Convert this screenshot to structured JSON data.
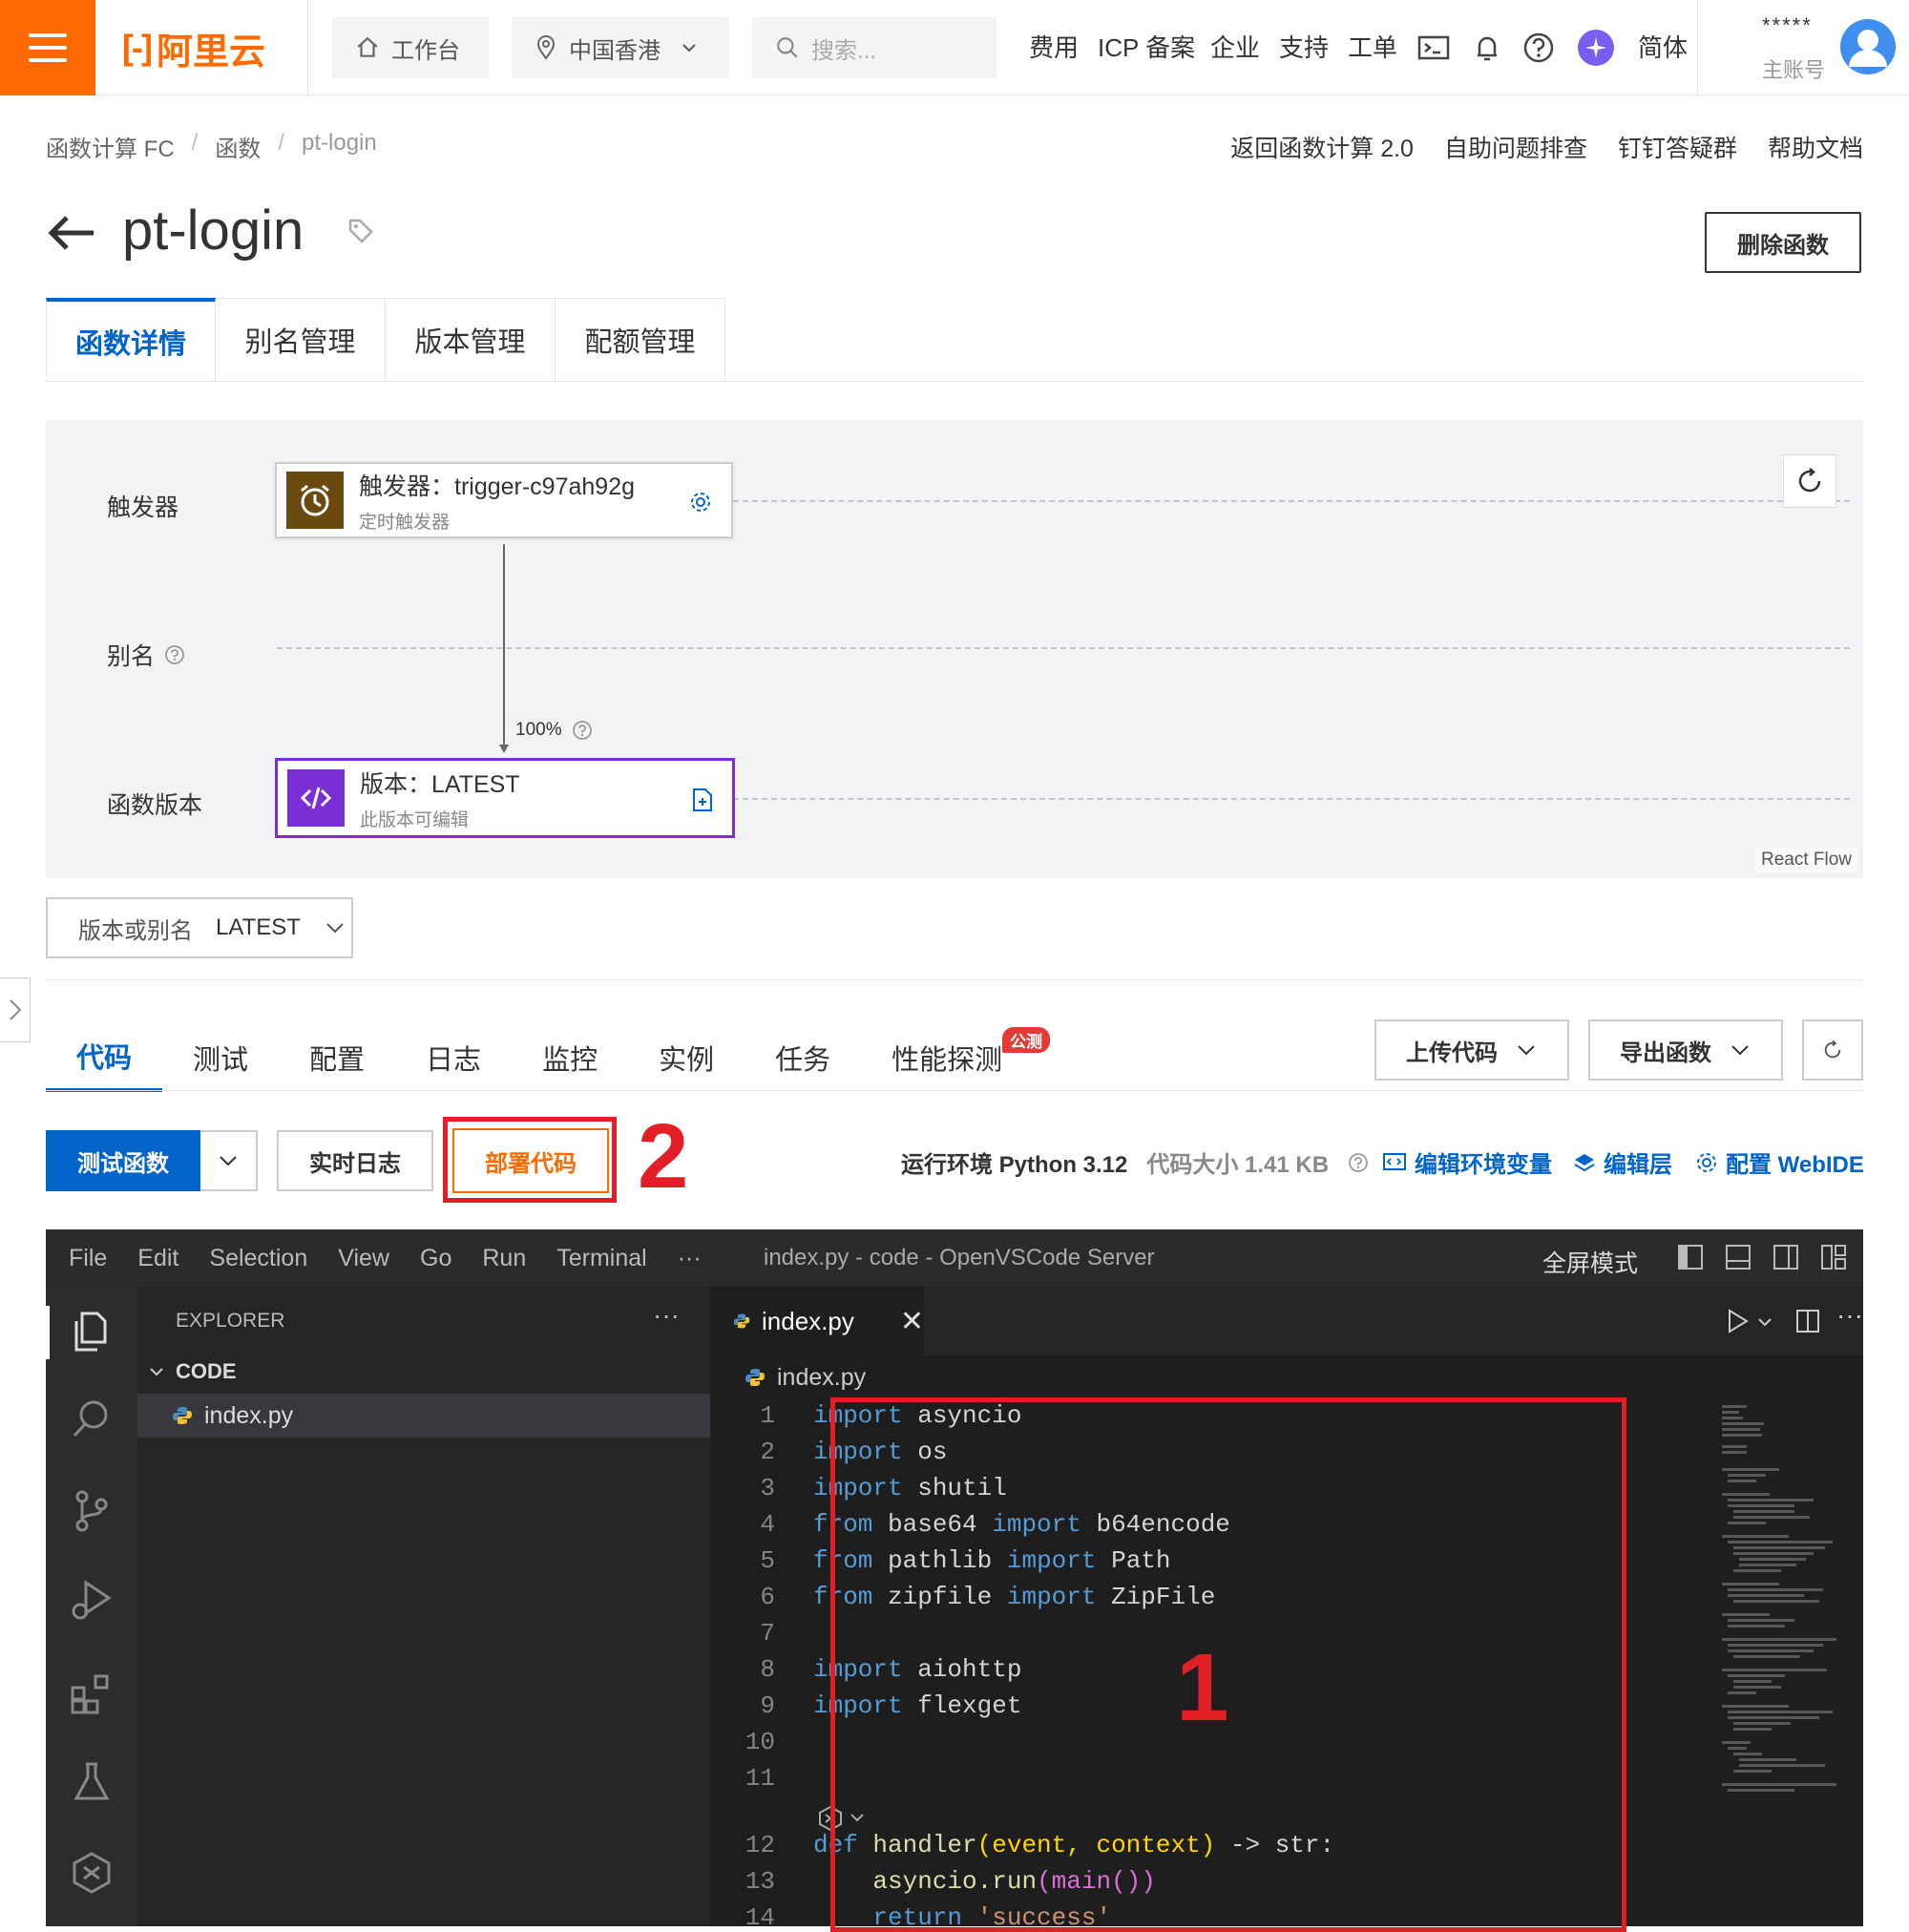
{
  "topbar": {
    "logo_text": "阿里云",
    "workbench": "工作台",
    "region": "中国香港",
    "search_placeholder": "搜索...",
    "links": [
      "费用",
      "ICP 备案",
      "企业",
      "支持",
      "工单"
    ],
    "lang": "简体",
    "account_mask": "*****",
    "account_role": "主账号",
    "brand_color": "#ff6a00"
  },
  "breadcrumb": [
    "函数计算 FC",
    "函数",
    "pt-login"
  ],
  "help_links": [
    "返回函数计算 2.0",
    "自助问题排查",
    "钉钉答疑群",
    "帮助文档"
  ],
  "page": {
    "title": "pt-login",
    "delete_label": "删除函数"
  },
  "main_tabs": [
    "函数详情",
    "别名管理",
    "版本管理",
    "配额管理"
  ],
  "flow": {
    "row_labels": [
      "触发器",
      "别名",
      "函数版本"
    ],
    "trigger": {
      "title": "触发器：trigger-c97ah92g",
      "subtitle": "定时触发器"
    },
    "percent": "100%",
    "version": {
      "title": "版本：LATEST",
      "subtitle": "此版本可编辑"
    },
    "attribution": "React Flow"
  },
  "version_select": {
    "label": "版本或别名",
    "value": "LATEST"
  },
  "sub_tabs": [
    "代码",
    "测试",
    "配置",
    "日志",
    "监控",
    "实例",
    "任务",
    "性能探测"
  ],
  "sub_tab_badge": "公测",
  "toolbar": {
    "upload": "上传代码",
    "export": "导出函数"
  },
  "actions": {
    "test": "测试函数",
    "logs": "实时日志",
    "deploy": "部署代码",
    "annotation_2": "2"
  },
  "runtime": {
    "env": "运行环境 Python 3.12",
    "size": "代码大小 1.41 KB",
    "edit_env": "编辑环境变量",
    "edit_layer": "编辑层",
    "webide": "配置 WebIDE"
  },
  "ide": {
    "menus": [
      "File",
      "Edit",
      "Selection",
      "View",
      "Go",
      "Run",
      "Terminal",
      "···"
    ],
    "window_title": "index.py - code - OpenVSCode Server",
    "fullscreen": "全屏模式",
    "explorer_title": "EXPLORER",
    "folder": "CODE",
    "file": "index.py",
    "tab": "index.py",
    "breadcrumb_file": "index.py",
    "annotation_1": "1",
    "line_numbers": [
      "1",
      "2",
      "3",
      "4",
      "5",
      "6",
      "7",
      "8",
      "9",
      "10",
      "11",
      "12",
      "13",
      "14"
    ],
    "code": {
      "l1_kw": "import",
      "l1_rest": " asyncio",
      "l2_kw": "import",
      "l2_rest": " os",
      "l3_kw": "import",
      "l3_rest": " shutil",
      "l4_kw": "from",
      "l4_mod": " base64 ",
      "l4_kw2": "import",
      "l4_rest": " b64encode",
      "l5_kw": "from",
      "l5_mod": " pathlib ",
      "l5_kw2": "import",
      "l5_rest": " Path",
      "l6_kw": "from",
      "l6_mod": " zipfile ",
      "l6_kw2": "import",
      "l6_rest": " ZipFile",
      "l8_kw": "import",
      "l8_rest": " aiohttp",
      "l9_kw": "import",
      "l9_rest": " flexget",
      "l12_kw": "def",
      "l12_fn": " handler",
      "l12_args": "(event, context)",
      "l12_rest": " -> str:",
      "l13_fn": "asyncio.run",
      "l13_args": "(main())",
      "l14_kw": "return",
      "l14_str": " 'success'"
    }
  }
}
